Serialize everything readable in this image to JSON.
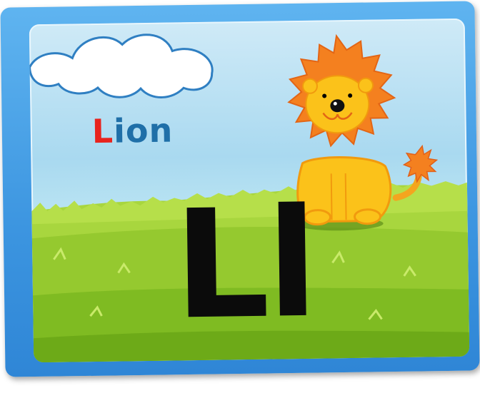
{
  "card": {
    "word_first_letter": "L",
    "word_rest": "ion",
    "big_letters": "Ll"
  },
  "colors": {
    "frame": "#3c95e0",
    "sky": "#b8e3f2",
    "grass": "#8ccc2c",
    "word_first_letter": "#e8231d",
    "word_rest": "#1f6fa8",
    "big_letters": "#0b0b0b",
    "lion_mane": "#f4801f",
    "lion_body": "#fbc21a"
  },
  "icons": [
    "cloud-illustration",
    "lion-illustration",
    "grass-field"
  ]
}
